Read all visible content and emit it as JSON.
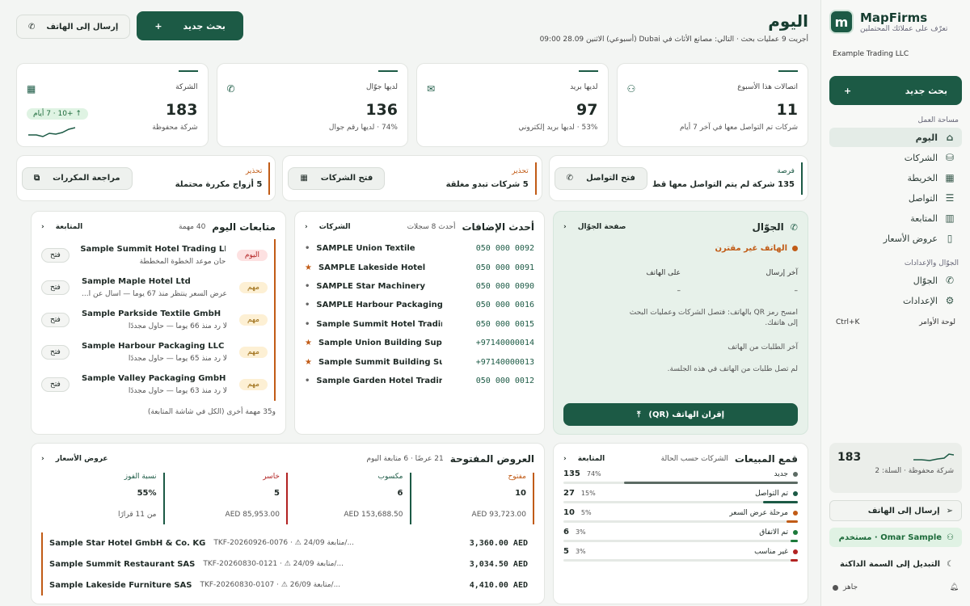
{
  "brand": {
    "name": "MapFirms",
    "tagline": "تعرّف على عملائك المحتملين",
    "logo_letter": "m",
    "company": "Example Trading LLC"
  },
  "sidebar": {
    "new_search": "بحث جديد",
    "new_search_icon": "+",
    "workspace_title": "مساحة العمل",
    "workspace_items": [
      {
        "label": "اليوم",
        "icon": "home"
      },
      {
        "label": "الشركات",
        "icon": "database"
      },
      {
        "label": "الخريطة",
        "icon": "map"
      },
      {
        "label": "التواصل",
        "icon": "list"
      },
      {
        "label": "المتابعة",
        "icon": "kanban"
      },
      {
        "label": "عروض الأسعار",
        "icon": "document"
      }
    ],
    "mobile_title": "الجوّال والإعدادات",
    "mobile_items": [
      {
        "label": "الجوّال",
        "icon": "phone"
      },
      {
        "label": "الإعدادات",
        "icon": "gear"
      }
    ],
    "command_palette": "لوحة الأوامر",
    "command_shortcut": "Ctrl+K",
    "stats": {
      "value": "183",
      "label": "شركة محفوظة · السلة: 2"
    },
    "send_to_phone": "إرسال إلى الهاتف",
    "user": "Omar Sample · مستخدم",
    "dark_mode": "التبديل إلى السمة الداكنة",
    "status": "جاهز"
  },
  "header": {
    "title": "اليوم",
    "meta": "أجريت 9 عمليات بحث · التالي: مصانع الأثاث في Dubai (أسبوعي) الاثنين 28.09 09:00",
    "new_search": "بحث جديد",
    "new_icon": "+",
    "send_phone": "إرسال إلى الهاتف"
  },
  "kpis": [
    {
      "label": "اتصالات هذا الأسبوع",
      "value": "11",
      "sub": "شركات تم التواصل معها في آخر 7 أيام",
      "icon": "users"
    },
    {
      "label": "لديها بريد",
      "value": "97",
      "sub": "53% · لديها بريد إلكتروني",
      "icon": "mail"
    },
    {
      "label": "لديها جوّال",
      "value": "136",
      "sub": "74% · لديها رقم جوال",
      "icon": "phone"
    },
    {
      "label": "الشركة",
      "value": "183",
      "sub": "شركة محفوظة",
      "icon": "building",
      "pill": "↑ +10 · 7 أيام"
    }
  ],
  "alerts": [
    {
      "kind": "فرصة",
      "text": "135 شركة لم يتم التواصل معها قط",
      "button": "فتح التواصل",
      "icon": "phone",
      "tone": "green"
    },
    {
      "kind": "تحذير",
      "text": "5 شركات تبدو مغلقة",
      "button": "فتح الشركات",
      "icon": "building",
      "tone": "orange"
    },
    {
      "kind": "تحذير",
      "text": "5 أزواج مكررة محتملة",
      "button": "مراجعة المكررات",
      "icon": "copy",
      "tone": "orange"
    }
  ],
  "phone_panel": {
    "title": "الجوّال",
    "link": "صفحة الجوّال",
    "status": "الهاتف غير مقترن",
    "on_phone_label": "على الهاتف",
    "on_phone_value": "–",
    "last_send_label": "آخر إرسال",
    "last_send_value": "–",
    "hint": "امسح رمز QR بالهاتف: فتصل الشركات وعمليات البحث إلى هاتفك.",
    "requests_label": "آخر الطلبات من الهاتف",
    "requests_empty": "لم تصل طلبات من الهاتف في هذه الجلسة.",
    "qr_button": "إقران الهاتف (QR)"
  },
  "recent": {
    "title": "أحدث الإضافات",
    "count": "أحدث 8 سجلات",
    "link": "الشركات",
    "items": [
      {
        "name": "SAMPLE Union Textile",
        "phone": "050 000 0092",
        "mark": "dot"
      },
      {
        "name": "SAMPLE Lakeside Hotel",
        "phone": "050 000 0091",
        "mark": "star"
      },
      {
        "name": "SAMPLE Star Machinery",
        "phone": "050 000 0090",
        "mark": "dot"
      },
      {
        "name": "SAMPLE Harbour Packaging LLC",
        "phone": "050 000 0016",
        "mark": "dot"
      },
      {
        "name": "Sample Summit Hotel Trading...",
        "phone": "050 000 0015",
        "mark": "dot"
      },
      {
        "name": "Sample Union Building Supplie...",
        "phone": "+97140000014",
        "mark": "star"
      },
      {
        "name": "Sample Summit Building Suppl...",
        "phone": "+97140000013",
        "mark": "star"
      },
      {
        "name": "Sample Garden Hotel Trading...",
        "phone": "050 000 0012",
        "mark": "dot"
      }
    ]
  },
  "followups": {
    "title": "متابعات اليوم",
    "count": "40 مهمة",
    "link": "المتابعة",
    "items": [
      {
        "name": "Sample Summit Hotel Trading LLC",
        "sub": "حان موعد الخطوة المخططة",
        "badge": "اليوم",
        "tone": "red",
        "button": "فتح"
      },
      {
        "name": "Sample Maple Hotel Ltd",
        "sub": "عرض السعر ينتظر منذ 67 يوما — اسأل عن ا...",
        "badge": "مهم",
        "tone": "amber",
        "button": "فتح"
      },
      {
        "name": "Sample Parkside Textile GmbH",
        "sub": "لا رد منذ 66 يوما — حاول مجددًا",
        "badge": "مهم",
        "tone": "amber",
        "button": "فتح"
      },
      {
        "name": "Sample Harbour Packaging LLC",
        "sub": "لا رد منذ 65 يوما — حاول مجددًا",
        "badge": "مهم",
        "tone": "amber",
        "button": "فتح"
      },
      {
        "name": "Sample Valley Packaging GmbH & C...",
        "sub": "لا رد منذ 63 يوما — حاول مجددًا",
        "badge": "مهم",
        "tone": "amber",
        "button": "فتح"
      }
    ],
    "more": "و35 مهمة أخرى (الكل في شاشة المتابعة)"
  },
  "funnel": {
    "title": "قمع المبيعات",
    "subtitle": "الشركات حسب الحالة",
    "link": "المتابعة",
    "rows": [
      {
        "label": "جديد",
        "count": "135",
        "pct": "74%",
        "value": 0.74,
        "color": "#5c6b64"
      },
      {
        "label": "تم التواصل",
        "count": "27",
        "pct": "15%",
        "value": 0.15,
        "color": "#1c5a45"
      },
      {
        "label": "مرحلة عرض السعر",
        "count": "10",
        "pct": "5%",
        "value": 0.05,
        "color": "#c15b16"
      },
      {
        "label": "تم الاتفاق",
        "count": "6",
        "pct": "3%",
        "value": 0.03,
        "color": "#1c7a3a"
      },
      {
        "label": "غير مناسب",
        "count": "5",
        "pct": "3%",
        "value": 0.03,
        "color": "#b22222"
      }
    ]
  },
  "quotes": {
    "title": "العروض المفتوحة",
    "count": "21 عرضًا · 6 متابعة اليوم",
    "link": "عروض الأسعار",
    "stats": [
      {
        "label": "نسبة الفوز",
        "value": "55%",
        "meta": "من 11 قرارًا",
        "tone": "green"
      },
      {
        "label": "خاسر",
        "value": "5",
        "meta": "85,953.00 AED",
        "tone": "red"
      },
      {
        "label": "مكسوب",
        "value": "6",
        "meta": "153,688.50 AED",
        "tone": "green"
      },
      {
        "label": "مفتوح",
        "value": "10",
        "meta": "93,723.00 AED",
        "tone": "orange"
      }
    ],
    "rows": [
      {
        "name": "Sample Star Hotel GmbH & Co. KG",
        "ref": "TKF-20260926-0076 · ⚠ 24/09 متابعة/...",
        "amount": "3,360.00 AED"
      },
      {
        "name": "Sample Summit Restaurant SAS",
        "ref": "TKF-20260830-0121 · ⚠ 24/09 متابعة/...",
        "amount": "3,034.50 AED"
      },
      {
        "name": "Sample Lakeside Furniture SAS",
        "ref": "TKF-20260830-0107 · ⚠ 26/09 متابعة/...",
        "amount": "4,410.00 AED"
      }
    ]
  }
}
